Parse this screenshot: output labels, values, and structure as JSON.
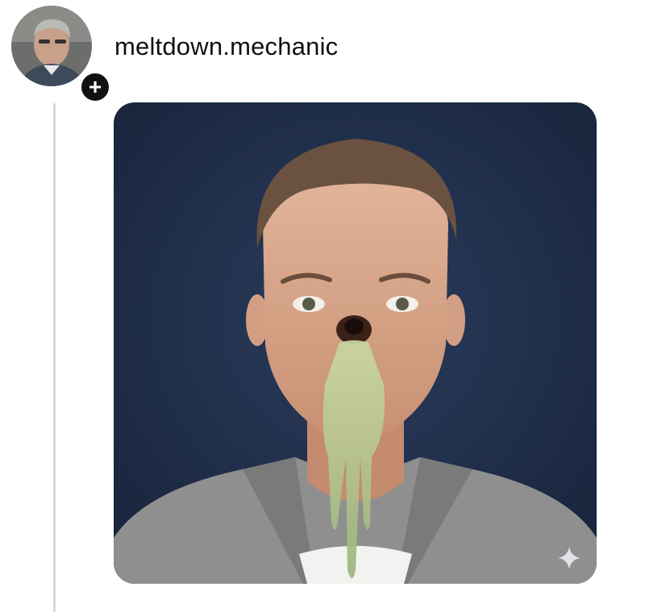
{
  "post": {
    "author": {
      "username": "meltdown.mechanic",
      "avatar_icon": "profile-photo-avatar",
      "follow_icon": "plus-icon",
      "follow_glyph": "+"
    },
    "image": {
      "subject": "portrait photo",
      "corner_icon": "sparkle-icon"
    }
  },
  "colors": {
    "background": "#ffffff",
    "text": "#111111",
    "thread_line": "#d9d9d9",
    "photo_backdrop": "#1f2f4d",
    "follow_button": "#111111"
  }
}
